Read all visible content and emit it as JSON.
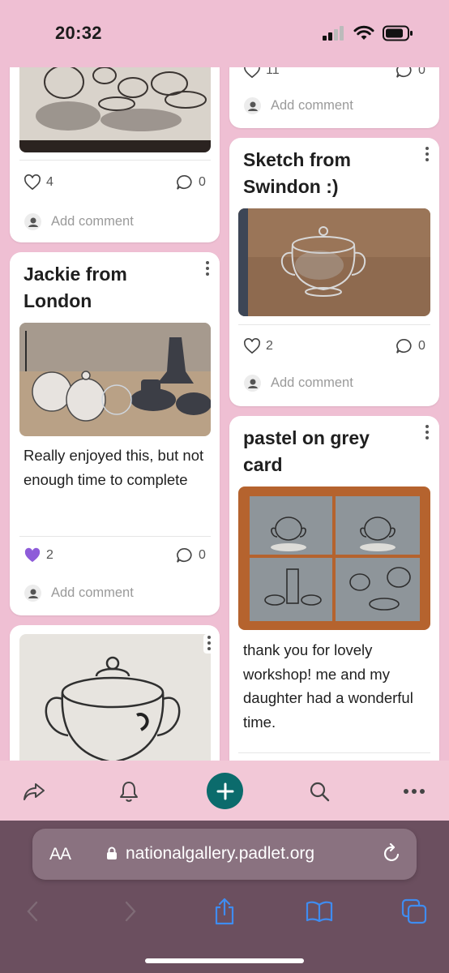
{
  "status_bar": {
    "time": "20:32"
  },
  "cards": {
    "c1": {
      "likes": "4",
      "comments": "0",
      "add_comment": "Add comment"
    },
    "c2": {
      "title": "Jackie from London",
      "body": "Really enjoyed this, but not enough time to complete",
      "likes": "2",
      "comments": "0",
      "add_comment": "Add comment"
    },
    "r1": {
      "likes": "11",
      "comments": "0",
      "add_comment": "Add comment"
    },
    "r2": {
      "title": "Sketch from Swindon :)",
      "likes": "2",
      "comments": "0",
      "add_comment": "Add comment"
    },
    "r3": {
      "title": "pastel on grey card",
      "body": "thank you for lovely workshop! me and my daughter had a wonderful time."
    }
  },
  "toolbar": {
    "icons": [
      "share-icon",
      "bell-icon",
      "plus-icon",
      "search-icon",
      "more-icon"
    ]
  },
  "browser": {
    "aa_label": "AA",
    "url": "nationalgallery.padlet.org"
  },
  "colors": {
    "background": "#efbfd3",
    "accent": "#0b6b6c",
    "liked_heart": "#8e5cd9",
    "safari_bar": "#6b4f5f"
  }
}
